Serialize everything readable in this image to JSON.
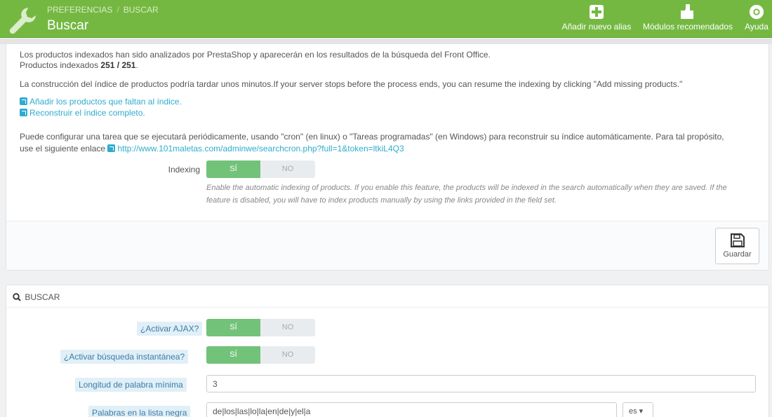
{
  "header": {
    "breadcrumb": [
      "PREFERENCIAS",
      "BUSCAR"
    ],
    "breadcrumb_sep": "/",
    "title": "Buscar",
    "buttons": [
      {
        "label": "Añadir nuevo alias",
        "icon": "plus-square-icon"
      },
      {
        "label": "Módulos recomendados",
        "icon": "puzzle-icon"
      },
      {
        "label": "Ayuda",
        "icon": "lifebuoy-icon"
      }
    ],
    "color": "#74b842"
  },
  "index_panel": {
    "intro": "Los productos indexados han sido analizados por PrestaShop y aparecerán en los resultados de la búsqueda del Front Office.",
    "indexed_label": "Productos indexados",
    "indexed_value": "251 / 251",
    "indexed_period": ".",
    "rebuild_note": "La construcción del índice de productos podría tardar unos minutos.If your server stops before the process ends, you can resume the indexing by clicking \"Add missing products.\"",
    "link_add_missing": "Añadir los productos que faltan al índice.",
    "link_rebuild": "Reconstruir el índice completo.",
    "cron_text_1": "Puede configurar una tarea que se ejecutará periódicamente, usando \"cron\" (en linux) o \"Tareas programadas\" (en Windows) para reconstruir su índice automáticamente. Para tal propósito,",
    "cron_text_2": "use el siguiente enlace",
    "cron_url": "http://www.101maletas.com/adminwe/searchcron.php?full=1&token=ltkiL4Q3",
    "indexing_label": "Indexing",
    "indexing_on": "SÍ",
    "indexing_off": "NO",
    "indexing_help": "Enable the automatic indexing of products. If you enable this feature, the products will be indexed in the search automatically when they are saved. If the feature is disabled, you will have to index products manually by using the links provided in the field set.",
    "save_label": "Guardar"
  },
  "search_panel": {
    "heading": "BUSCAR",
    "ajax_label": "¿Activar AJAX?",
    "ajax_on": "SÍ",
    "ajax_off": "NO",
    "instant_label": "¿Activar búsqueda instantánea?",
    "instant_on": "SÍ",
    "instant_off": "NO",
    "min_word_label": "Longitud de palabra mínima",
    "min_word_value": "3",
    "blacklist_label": "Palabras en la lista negra",
    "blacklist_value": "de|los|las|lo|la|en|de|y|el|a",
    "lang_value": "es ▾"
  },
  "colors": {
    "switch_on": "#72c279",
    "link": "#2eacce"
  }
}
